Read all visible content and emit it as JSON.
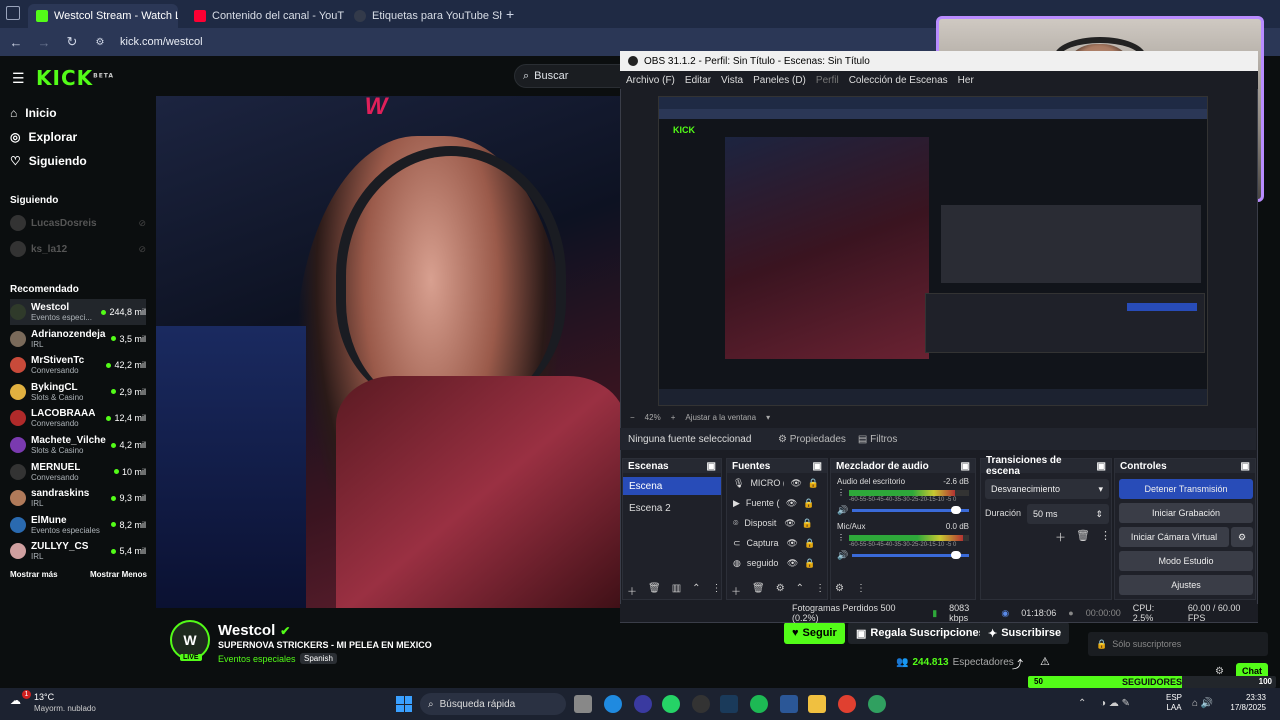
{
  "browser": {
    "tabs": [
      {
        "label": "Westcol Stream - Watch Li",
        "fav_color": "#53fc18"
      },
      {
        "label": "Contenido del canal - YouTube",
        "fav_color": "#ff0033"
      },
      {
        "label": "Etiquetas para YouTube Shorts",
        "fav_color": "#333a4a"
      }
    ],
    "url": "kick.com/westcol"
  },
  "kick": {
    "logo": "KICK",
    "logo_sup": "BETA",
    "search_placeholder": "Buscar",
    "nav": [
      "Inicio",
      "Explorar",
      "Siguiendo"
    ],
    "following_title": "Siguiendo",
    "following": [
      {
        "name": "LucasDosreis"
      },
      {
        "name": "ks_la12"
      }
    ],
    "recommended_title": "Recomendado",
    "recommended": [
      {
        "name": "Westcol",
        "cat": "Eventos especi...",
        "viewers": "244,8 mil",
        "color": "#2f3a2a"
      },
      {
        "name": "Adrianozendeja...",
        "cat": "IRL",
        "viewers": "3,5 mil",
        "color": "#7a6a5a"
      },
      {
        "name": "MrStivenTc",
        "cat": "Conversando",
        "viewers": "42,2 mil",
        "color": "#c84a3a"
      },
      {
        "name": "BykingCL",
        "cat": "Slots & Casino",
        "viewers": "2,9 mil",
        "color": "#e0b040"
      },
      {
        "name": "LACOBRAAA",
        "cat": "Conversando",
        "viewers": "12,4 mil",
        "color": "#b02a2a"
      },
      {
        "name": "Machete_Vilches",
        "cat": "Slots & Casino",
        "viewers": "4,2 mil",
        "color": "#7a3ab0"
      },
      {
        "name": "MERNUEL",
        "cat": "Conversando",
        "viewers": "10 mil",
        "color": "#333"
      },
      {
        "name": "sandraskins",
        "cat": "IRL",
        "viewers": "9,3 mil",
        "color": "#b07a5a"
      },
      {
        "name": "ElMune",
        "cat": "Eventos especiales",
        "viewers": "8,2 mil",
        "color": "#2a6ab0"
      },
      {
        "name": "ZULLYY_CS",
        "cat": "IRL",
        "viewers": "5,4 mil",
        "color": "#d0a0a0"
      }
    ],
    "show_more": "Mostrar más",
    "show_less": "Mostrar Menos",
    "stream": {
      "channel": "Westcol",
      "title": "SUPERNOVA STRICKERS - MI PELEA EN MEXICO",
      "category": "Eventos especiales",
      "language": "Spanish",
      "follow": "Seguir",
      "gift": "Regala Suscripciones",
      "subscribe": "Suscribirse",
      "viewers": "244.813",
      "viewers_label": "Espectadores",
      "live_badge": "LIVE"
    },
    "chat": {
      "subs_only": "Sólo suscriptores",
      "chat_btn": "Chat",
      "goal_left": "50",
      "goal_label": "SEGUIDORES",
      "goal_right": "100",
      "goal_progress": 0.62
    }
  },
  "obs": {
    "title": "OBS 31.1.2 - Perfil: Sin Título - Escenas: Sin Título",
    "menu": [
      "Archivo (F)",
      "Editar",
      "Vista",
      "Paneles (D)",
      "Perfil",
      "Colección de Escenas",
      "Her"
    ],
    "zoom": "42%",
    "fit": "Ajustar a la ventana",
    "no_source": "Ninguna fuente seleccionad",
    "properties": "Propiedades",
    "filters": "Filtros",
    "scenes_title": "Escenas",
    "scenes": [
      "Escena",
      "Escena 2"
    ],
    "sources_title": "Fuentes",
    "sources": [
      "MICRO (",
      "Fuente (",
      "Disposit",
      "Captura",
      "seguido"
    ],
    "mixer_title": "Mezclador de audio",
    "mixer": [
      {
        "name": "Audio del escritorio",
        "db": "-2.6 dB",
        "level": 0.88
      },
      {
        "name": "Mic/Aux",
        "db": "0.0 dB",
        "level": 0.95
      }
    ],
    "meter_scale": "-60-55-50-45-40-35-30-25-20-15-10 -5 0",
    "transitions_title": "Transiciones de escena",
    "transition": "Desvanecimiento",
    "duration_label": "Duración",
    "duration": "50 ms",
    "controls_title": "Controles",
    "controls": [
      "Detener Transmisión",
      "Iniciar Grabación",
      "Iniciar Cámara Virtual",
      "Modo Estudio",
      "Ajustes"
    ],
    "status": {
      "dropped": "Fotogramas Perdidos 500 (0.2%)",
      "bitrate": "8083 kbps",
      "live_time": "01:18:06",
      "rec_time": "00:00:00",
      "cpu": "CPU: 2.5%",
      "fps": "60.00 / 60.00 FPS"
    }
  },
  "taskbar": {
    "temp": "13°C",
    "weather": "Mayorm. nublado",
    "badge": "1",
    "search": "Búsqueda rápida",
    "lang1": "ESP",
    "lang2": "LAA",
    "time": "23:33",
    "date": "17/8/2025"
  }
}
